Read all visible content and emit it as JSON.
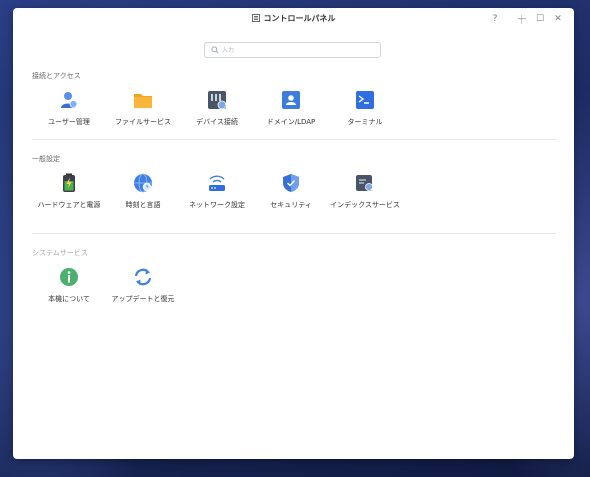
{
  "window": {
    "title": "コントロールパネル",
    "help": "?",
    "minimize": "—",
    "maximize": "☐",
    "close": "✕"
  },
  "search": {
    "placeholder": "入力",
    "value": ""
  },
  "sections": [
    {
      "title": "接続とアクセス",
      "items": [
        {
          "label": "ユーザー管理",
          "icon": "user-management-icon"
        },
        {
          "label": "ファイルサービス",
          "icon": "file-service-icon"
        },
        {
          "label": "デバイス接続",
          "icon": "device-connection-icon"
        },
        {
          "label": "ドメイン/LDAP",
          "icon": "domain-ldap-icon"
        },
        {
          "label": "ターミナル",
          "icon": "terminal-icon"
        }
      ]
    },
    {
      "title": "一般設定",
      "items": [
        {
          "label": "ハードウェアと電源",
          "icon": "hardware-power-icon"
        },
        {
          "label": "時刻と言語",
          "icon": "time-language-icon"
        },
        {
          "label": "ネットワーク設定",
          "icon": "network-settings-icon"
        },
        {
          "label": "セキュリティ",
          "icon": "security-icon"
        },
        {
          "label": "インデックスサービス",
          "icon": "index-service-icon"
        }
      ]
    },
    {
      "title": "システムサービス",
      "items": [
        {
          "label": "本機について",
          "icon": "info-icon"
        },
        {
          "label": "アップデートと復元",
          "icon": "update-restore-icon"
        }
      ]
    }
  ]
}
